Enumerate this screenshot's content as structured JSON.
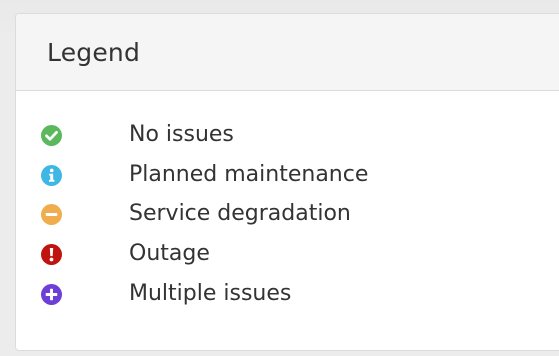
{
  "panel": {
    "title": "Legend"
  },
  "legend": {
    "items": [
      {
        "label": "No issues",
        "icon": "check-circle-icon",
        "color": "#5cb85c"
      },
      {
        "label": "Planned maintenance",
        "icon": "info-circle-icon",
        "color": "#3fb7e5"
      },
      {
        "label": "Service degradation",
        "icon": "minus-circle-icon",
        "color": "#f0ad4e"
      },
      {
        "label": "Outage",
        "icon": "exclamation-circle-icon",
        "color": "#c0120f"
      },
      {
        "label": "Multiple issues",
        "icon": "plus-circle-icon",
        "color": "#6e3fd6"
      }
    ]
  }
}
